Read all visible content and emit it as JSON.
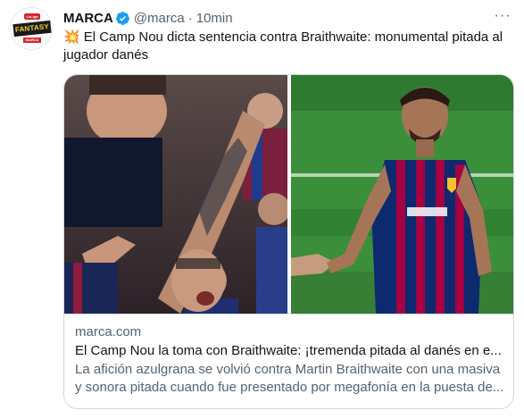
{
  "account": {
    "name": "MARCA",
    "handle": "@marca",
    "separator": "·",
    "time": "10min",
    "verified_icon": "verified-badge-icon",
    "avatar_texts": {
      "league": "LaLiga",
      "fantasy": "FANTASY",
      "brand": "MARCA"
    }
  },
  "tweet": {
    "emoji": "💥",
    "text": "El Camp Nou dicta sentencia contra Braithwaite: monumental pitada al jugador danés"
  },
  "card": {
    "domain": "marca.com",
    "title": "El Camp Nou la toma con Braithwaite: ¡tremenda pitada al danés en e...",
    "description": "La afición azulgrana se volvió contra Martin Braithwaite con una masiva y sonora pitada cuando fue presentado por megafonía en la puesta de..."
  },
  "colors": {
    "text_primary": "#0f1419",
    "text_secondary": "#536471",
    "border": "#cfd9de",
    "verified": "#1d9bf0",
    "barca_blue": "#0d2a6e",
    "barca_red": "#a50044",
    "pitch_green": "#3b8f3a"
  }
}
